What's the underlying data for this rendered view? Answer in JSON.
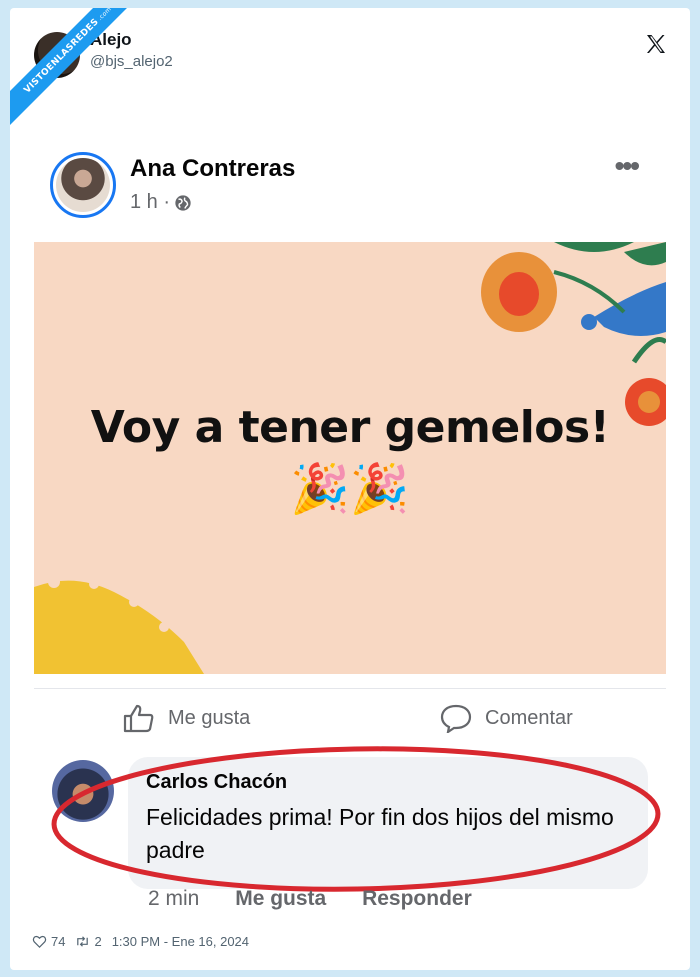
{
  "watermark": {
    "text": "VISTOENLASREDES",
    "suffix": ".com"
  },
  "tweet": {
    "author_name": "Alejo",
    "author_handle": "@bjs_alejo2",
    "likes": "74",
    "retweets": "2",
    "timestamp": "1:30 PM - Ene 16, 2024"
  },
  "fb_post": {
    "author": "Ana Contreras",
    "time": "1 h ·",
    "banner_text": "Voy a tener gemelos!",
    "banner_emoji": "🎉🎉",
    "like_label": "Me gusta",
    "comment_label": "Comentar"
  },
  "comment": {
    "author": "Carlos Chacón",
    "text": "Felicidades prima! Por fin dos hijos del mismo padre",
    "time": "2 min",
    "like_label": "Me gusta",
    "reply_label": "Responder"
  },
  "colors": {
    "fb_blue": "#1877f2",
    "twitter_blue": "#1d9bf0",
    "highlight_red": "#d8282f",
    "banner_bg": "#f8d8c3"
  }
}
